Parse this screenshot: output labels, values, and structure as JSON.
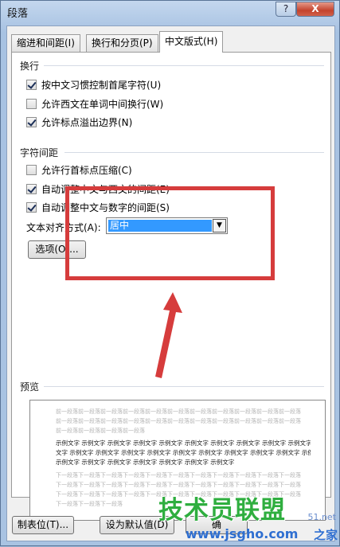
{
  "window": {
    "title": "段落",
    "help_label": "?",
    "close_label": "X"
  },
  "tabs": [
    {
      "label": "缩进和间距(I)"
    },
    {
      "label": "换行和分页(P)"
    },
    {
      "label": "中文版式(H)"
    }
  ],
  "section_wrap": {
    "title": "换行",
    "options": [
      {
        "label": "按中文习惯控制首尾字符(U)",
        "checked": true
      },
      {
        "label": "允许西文在单词中间换行(W)",
        "checked": false
      },
      {
        "label": "允许标点溢出边界(N)",
        "checked": true
      }
    ]
  },
  "section_spacing": {
    "title": "字符间距",
    "options": [
      {
        "label": "允许行首标点压缩(C)",
        "checked": false
      },
      {
        "label": "自动调整中文与西文的间距(E)",
        "checked": true
      },
      {
        "label": "自动调整中文与数字的间距(S)",
        "checked": true
      }
    ],
    "align_label": "文本对齐方式(A):",
    "align_value": "居中",
    "options_button": "选项(O)..."
  },
  "preview": {
    "title": "预览",
    "before_lines": [
      "前一段落前一段落前一段落前一段落前一段落前一段落前一段落前一段落前一段落前一段落前一段落",
      "前一段落前一段落前一段落前一段落前一段落前一段落前一段落前一段落前一段落前一段落前一段落",
      "前一段落前一段落前一段落前一段落"
    ],
    "sample_lines": [
      "示例文字 示例文字 示例文字 示例文字 示例文字 示例文字 示例文字 示例文字 示例文字 示例文字",
      "文字 示例文字 示例文字 示例文字 示例文字 示例文字 示例文字 示例文字 示例文字 示例文字 示例",
      "示例文字 示例文字 示例文字 示例文字 示例文字 示例文字 示例文字"
    ],
    "after_lines": [
      "下一段落下一段落下一段落下一段落下一段落下一段落下一段落下一段落下一段落下一段落下一段落",
      "下一段落下一段落下一段落下一段落下一段落下一段落下一段落下一段落下一段落下一段落下一段落",
      "下一段落下一段落下一段落下一段落下一段落下一段落下一段落下一段落下一段落下一段落下一段落",
      "下一段落下一段落下一段落"
    ]
  },
  "footer": {
    "tabs_button": "制表位(T)...",
    "default_button": "设为默认值(D)",
    "ok_button": "确"
  },
  "watermark": {
    "title": "技术员联盟",
    "site": "www.jsgho.com",
    "side": "之家",
    "net": "51.net"
  }
}
